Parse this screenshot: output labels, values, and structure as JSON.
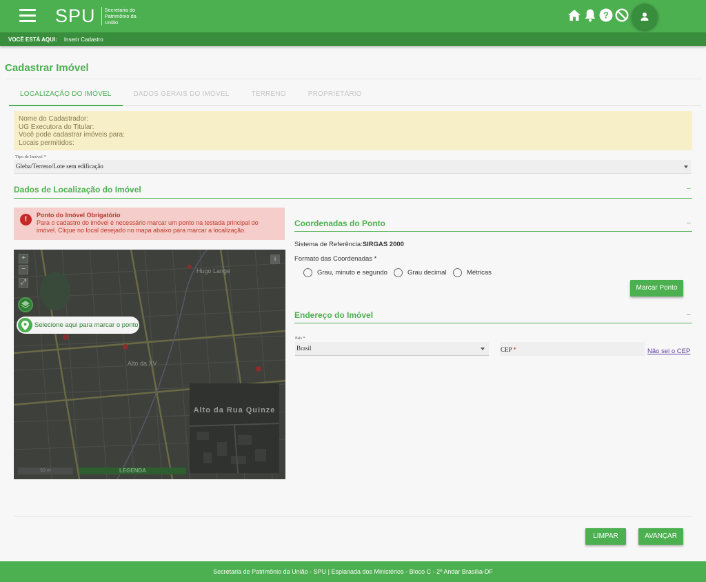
{
  "header": {
    "logo": "SPU",
    "logo_subtitle": "Secretaria do Patrimônio da União",
    "icons": [
      "home-icon",
      "bell-icon",
      "help-icon",
      "block-icon",
      "user-icon"
    ]
  },
  "breadcrumb": {
    "label": "VOCÊ ESTÁ AQUI:",
    "current": "Inserir Cadastro"
  },
  "page": {
    "title": "Cadastrar Imóvel"
  },
  "tabs": [
    {
      "label": "LOCALIZAÇÃO DO IMÓVEL",
      "active": true
    },
    {
      "label": "DADOS GERAIS DO IMÓVEL",
      "active": false
    },
    {
      "label": "TERRENO",
      "active": false
    },
    {
      "label": "PROPRIETÁRIO",
      "active": false
    }
  ],
  "info": {
    "lines": [
      "Nome do Cadastrador:",
      "UG Executora do Titular:",
      "Você pode cadastrar imóveis para:",
      "Locais permitidos:"
    ]
  },
  "tipo_imovel": {
    "label": "Tipo de Imóvel *",
    "value": "Gleba/Terreno/Lote sem edificação"
  },
  "localizacao": {
    "title": "Dados de Localização do Imóvel",
    "collapse": "–"
  },
  "alert": {
    "icon": "!",
    "title": "Ponto do Imóvel Obrigatório",
    "message": "Para o cadastro do imóvel é necessário marcar um ponto na testada principal do imóvel. Clique no local desejado no mapa abaixo para marcar a localização."
  },
  "map": {
    "zoom_in": "+",
    "zoom_out": "−",
    "fullscreen": "⤢",
    "info": "i",
    "marker_chip": "Selecione aqui para marcar o ponto",
    "labels": [
      "Hugo Lange",
      "Alto da XV",
      "Alto da Rua Quinze"
    ],
    "legend": "LEGENDA",
    "scale": "50 m"
  },
  "coordenadas": {
    "title": "Coordenadas do Ponto",
    "collapse": "–",
    "referencia_label": "Sistema de Referência:",
    "referencia_value": "SIRGAS 2000",
    "formato_label": "Formato das Coordenadas *",
    "options": [
      "Grau, minuto e segundo",
      "Grau decimal",
      "Métricas"
    ],
    "marcar_button": "Marcar Ponto"
  },
  "endereco": {
    "title": "Endereço do Imóvel",
    "collapse": "–",
    "pais_label": "País *",
    "pais_value": "Brasil",
    "cep_label": "CEP",
    "cep_required": "*",
    "cep_link": "Não sei o CEP"
  },
  "actions": {
    "limpar": "LIMPAR",
    "avancar": "AVANÇAR"
  },
  "footer": {
    "text": "Secretaria de Patrimônio da União - SPU | Esplanada dos Ministérios - Bloco C - 2º Andar Brasília-DF"
  },
  "colors": {
    "primary": "#4caf50",
    "primary_dark": "#388e3c",
    "info_bg": "#f6efc8",
    "alert_bg": "#f5cdcb"
  }
}
